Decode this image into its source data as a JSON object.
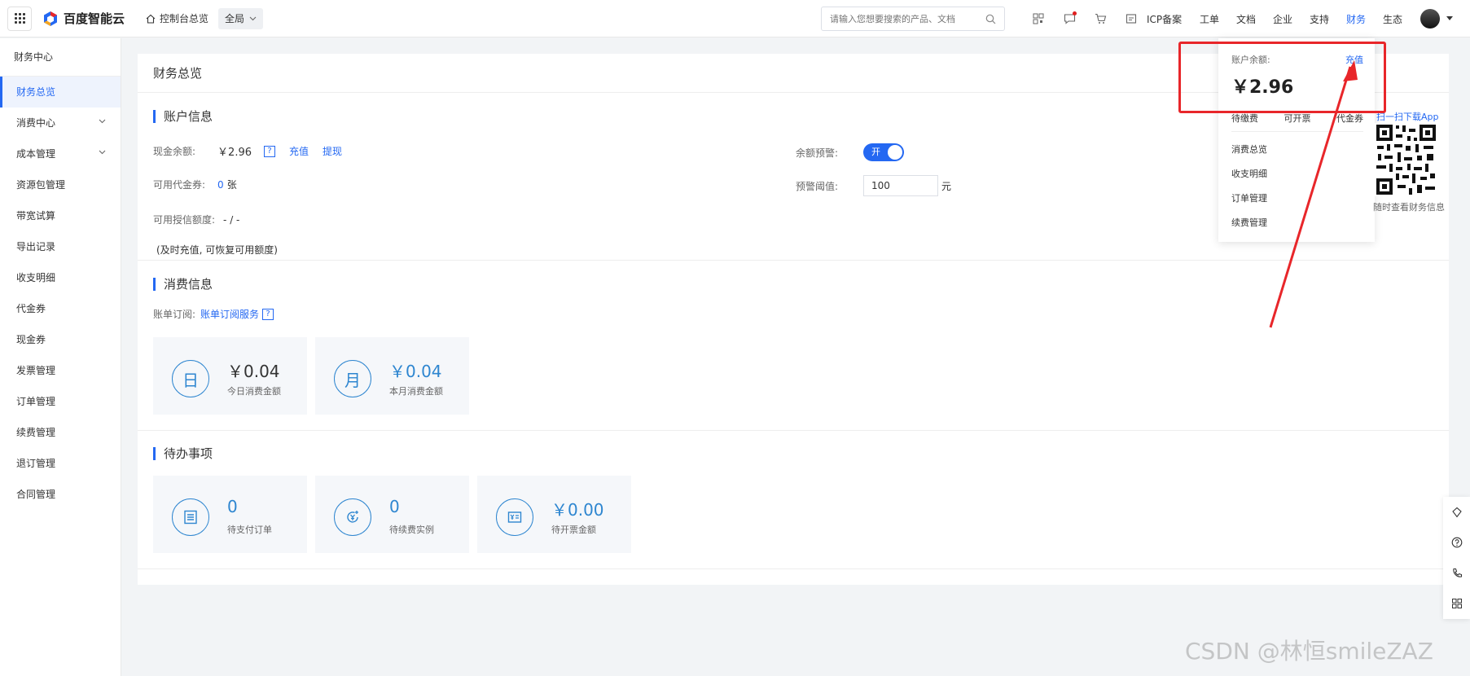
{
  "topbar": {
    "brand": "百度智能云",
    "home_label": "控制台总览",
    "scope_label": "全局",
    "search_placeholder": "请输入您想要搜索的产品、文档",
    "links": [
      "ICP备案",
      "工单",
      "文档",
      "企业",
      "支持",
      "财务",
      "生态"
    ],
    "active_link": "财务"
  },
  "sidebar": {
    "title": "财务中心",
    "items": [
      {
        "label": "财务总览",
        "active": true
      },
      {
        "label": "消费中心",
        "expandable": true
      },
      {
        "label": "成本管理",
        "expandable": true
      },
      {
        "label": "资源包管理"
      },
      {
        "label": "带宽试算"
      },
      {
        "label": "导出记录"
      },
      {
        "label": "收支明细"
      },
      {
        "label": "代金券"
      },
      {
        "label": "现金券"
      },
      {
        "label": "发票管理"
      },
      {
        "label": "订单管理"
      },
      {
        "label": "续费管理"
      },
      {
        "label": "退订管理"
      },
      {
        "label": "合同管理"
      }
    ]
  },
  "main": {
    "title": "财务总览",
    "account": {
      "heading": "账户信息",
      "cash_label": "现金余额:",
      "cash_value": "￥2.96",
      "recharge_link": "充值",
      "withdraw_link": "提现",
      "voucher_label": "可用代金券:",
      "voucher_count": "0",
      "voucher_unit": "张",
      "credit_label": "可用授信额度:",
      "credit_value": "- / -",
      "credit_note": "(及时充值, 可恢复可用额度)",
      "alert_label": "余额预警:",
      "alert_toggle": "开",
      "threshold_label": "预警阈值:",
      "threshold_value": "100",
      "threshold_unit": "元"
    },
    "consumption": {
      "heading": "消费信息",
      "subscribe_label": "账单订阅:",
      "subscribe_link": "账单订阅服务",
      "cards": [
        {
          "icon": "日",
          "value": "￥0.04",
          "label": "今日消费金额"
        },
        {
          "icon": "月",
          "value": "￥0.04",
          "label": "本月消费金额"
        }
      ]
    },
    "todo": {
      "heading": "待办事项",
      "cards": [
        {
          "value": "0",
          "label": "待支付订单"
        },
        {
          "value": "0",
          "label": "待续费实例"
        },
        {
          "value": "￥0.00",
          "label": "待开票金额"
        }
      ]
    }
  },
  "dropdown": {
    "balance_label": "账户余额:",
    "recharge_label": "充值",
    "balance_value": "￥2.96",
    "tabs": [
      "待缴费",
      "可开票",
      "代金券"
    ],
    "menu": [
      "消费总览",
      "收支明细",
      "订单管理",
      "续费管理"
    ],
    "qr_top_label": "扫一扫下载App",
    "qr_bottom_label": "随时查看财务信息"
  },
  "watermark": "CSDN @林恒smileZAZ",
  "colors": {
    "accent": "#2468f2",
    "highlight": "#e8262a"
  }
}
